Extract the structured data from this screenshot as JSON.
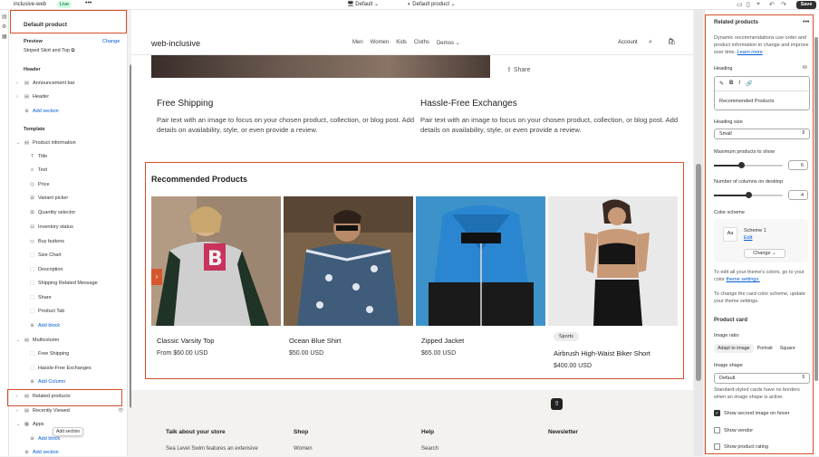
{
  "topbar": {
    "store": "inclusive-web",
    "live": "Live",
    "menu": "•••",
    "theme": "Default",
    "template": "Default product",
    "save": "Save"
  },
  "sidebar": {
    "title": "Default product",
    "preview_label": "Preview",
    "preview_change": "Change",
    "preview_value": "Striped Skirt and Top",
    "header_group": "Header",
    "header_items": [
      "Announcement bar",
      "Header"
    ],
    "add_section": "Add section",
    "template_group": "Template",
    "product_information": "Product information",
    "product_blocks": [
      "Title",
      "Text",
      "Price",
      "Variant picker",
      "Quantity selector",
      "Inventory status",
      "Buy buttons",
      "Size Chart",
      "Description",
      "Shipping Related Message",
      "Share",
      "Product Tab"
    ],
    "add_block": "Add block",
    "multicolumn": "Multicolumn",
    "multicolumn_items": [
      "Free Shipping",
      "Hassle-Free Exchanges"
    ],
    "add_column": "Add Column",
    "related_products": "Related products",
    "recently_viewed": "Recently Viewed",
    "apps": "Apps",
    "apps_add_block": "Add block",
    "add_section_bottom": "Add section",
    "tooltip": "Add section"
  },
  "preview": {
    "logo": "web-inclusive",
    "nav": [
      "Men",
      "Women",
      "Kids",
      "Cloths",
      "Demos"
    ],
    "account": "Account",
    "share": "Share",
    "features": [
      {
        "title": "Free Shipping",
        "text": "Pair text with an image to focus on your chosen product, collection, or blog post. Add details on availability, style, or even provide a review."
      },
      {
        "title": "Hassle-Free Exchanges",
        "text": "Pair text with an image to focus on your chosen product, collection, or blog post. Add details on availability, style, or even provide a review."
      }
    ],
    "recommended_title": "Recommended Products",
    "products": [
      {
        "name": "Classic Varsity Top",
        "price": "From $60.00 USD",
        "badge": ""
      },
      {
        "name": "Ocean Blue Shirt",
        "price": "$50.00 USD",
        "badge": ""
      },
      {
        "name": "Zipped Jacket",
        "price": "$65.00 USD",
        "badge": ""
      },
      {
        "name": "Airbrush High-Waist Biker Short",
        "price": "$400.00 USD",
        "badge": "Sports"
      }
    ],
    "footer": {
      "col1_title": "Talk about your store",
      "col1_text": "Sea Level Swim features an extensive",
      "col2_title": "Shop",
      "col2_text": "Women",
      "col3_title": "Help",
      "col3_text": "Search",
      "col4_title": "Newsletter"
    }
  },
  "settings": {
    "title": "Related products",
    "menu": "•••",
    "desc": "Dynamic recommendations use order and product information to change and improve over time.",
    "learn_more": "Learn more",
    "heading_label": "Heading",
    "heading_value": "Recommended Products",
    "heading_size_label": "Heading size",
    "heading_size_value": "Small",
    "max_products_label": "Maximum products to show",
    "max_products_value": "6",
    "max_products_fraction": 0.4,
    "columns_label": "Number of columns on desktop",
    "columns_value": "4",
    "columns_fraction": 0.5,
    "color_scheme_label": "Color scheme",
    "scheme_swatch": "Aa",
    "scheme_name": "Scheme 1",
    "scheme_edit": "Edit",
    "scheme_change": "Change",
    "edit_note": "To edit all your theme's colors, go to your color",
    "theme_settings": "theme settings.",
    "card_note": "To change the card color scheme, update your theme settings.",
    "product_card_label": "Product card",
    "image_ratio_label": "Image ratio",
    "image_ratio_options": [
      "Adapt to image",
      "Portrait",
      "Square"
    ],
    "image_shape_label": "Image shape",
    "image_shape_value": "Default",
    "image_shape_note": "Standard-styled cards have no borders when an image shape is active.",
    "second_image": "Show second image on hover",
    "show_vendor": "Show vendor",
    "show_rating": "Show product rating"
  },
  "colors": {
    "highlight": "#d54e2b",
    "link": "#005bd3",
    "arrow": "#d5572d"
  }
}
